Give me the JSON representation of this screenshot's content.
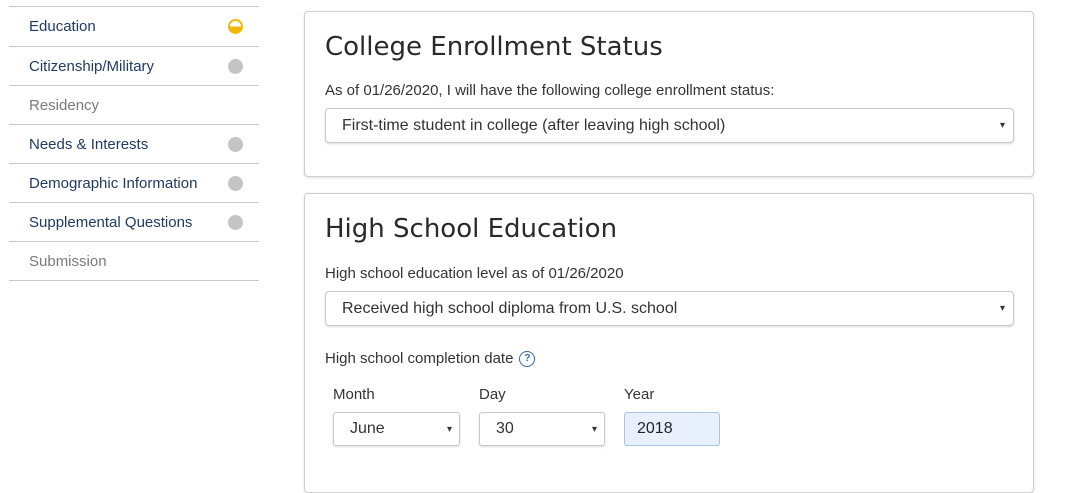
{
  "sidebar": {
    "items": [
      {
        "label": "Education",
        "status": "in-progress"
      },
      {
        "label": "Citizenship/Military",
        "status": "incomplete"
      },
      {
        "label": "Residency",
        "status": "locked"
      },
      {
        "label": "Needs & Interests",
        "status": "incomplete"
      },
      {
        "label": "Demographic Information",
        "status": "incomplete"
      },
      {
        "label": "Supplemental Questions",
        "status": "incomplete"
      },
      {
        "label": "Submission",
        "status": "locked"
      }
    ]
  },
  "enrollment": {
    "title": "College Enrollment Status",
    "label": "As of 01/26/2020, I will have the following college enrollment status:",
    "selected": "First-time student in college (after leaving high school)"
  },
  "high_school": {
    "title": "High School Education",
    "level_label": "High school education level as of 01/26/2020",
    "level_selected": "Received high school diploma from U.S. school",
    "completion_label": "High school completion date",
    "help_icon": "?",
    "month_label": "Month",
    "month_value": "June",
    "day_label": "Day",
    "day_value": "30",
    "year_label": "Year",
    "year_value": "2018"
  },
  "icons": {
    "caret": "▾"
  },
  "colors": {
    "nav_text": "#1f3b63",
    "in_progress": "#f2b705",
    "incomplete": "#c4c4c4",
    "help": "#2a6cb0",
    "autofill": "#e8f0fe"
  }
}
